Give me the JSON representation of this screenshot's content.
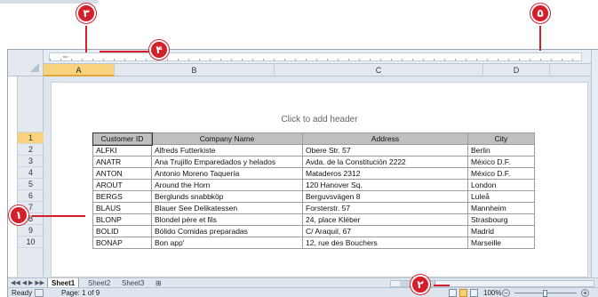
{
  "callouts": {
    "c1": "١",
    "c2": "٢",
    "c3": "٣",
    "c4": "۴",
    "c5": "۵"
  },
  "columns": [
    "A",
    "B",
    "C",
    "D"
  ],
  "rows": [
    "1",
    "2",
    "3",
    "4",
    "5",
    "6",
    "7",
    "8",
    "9",
    "10"
  ],
  "page": {
    "header_placeholder": "Click to add header"
  },
  "table": {
    "headers": [
      "Customer ID",
      "Company Name",
      "Address",
      "City"
    ],
    "rows": [
      [
        "ALFKI",
        "Alfreds Futterkiste",
        "Obere Str. 57",
        "Berlin"
      ],
      [
        "ANATR",
        "Ana Trujillo Emparedados y helados",
        "Avda. de la Constitución 2222",
        "México D.F."
      ],
      [
        "ANTON",
        "Antonio Moreno Taquería",
        "Mataderos  2312",
        "México D.F."
      ],
      [
        "AROUT",
        "Around the Horn",
        "120 Hanover Sq.",
        "London"
      ],
      [
        "BERGS",
        "Berglunds snabbköp",
        "Berguvsvägen  8",
        "Luleå"
      ],
      [
        "BLAUS",
        "Blauer See Delikatessen",
        "Forsterstr. 57",
        "Mannheim"
      ],
      [
        "BLONP",
        "Blondel père et fils",
        "24, place Kléber",
        "Strasbourg"
      ],
      [
        "BOLID",
        "Bólido Comidas preparadas",
        "C/ Araquil, 67",
        "Madrid"
      ],
      [
        "BONAP",
        "Bon app'",
        "12, rue des Bouchers",
        "Marseille"
      ]
    ]
  },
  "sheets": [
    "Sheet1",
    "Sheet2",
    "Sheet3"
  ],
  "status": {
    "ready": "Ready",
    "page_info": "Page: 1 of 9",
    "zoom": "100%"
  },
  "colors": {
    "callout": "#d3202b",
    "selected_header": "#f8d27c",
    "table_header": "#bfbfbf"
  }
}
